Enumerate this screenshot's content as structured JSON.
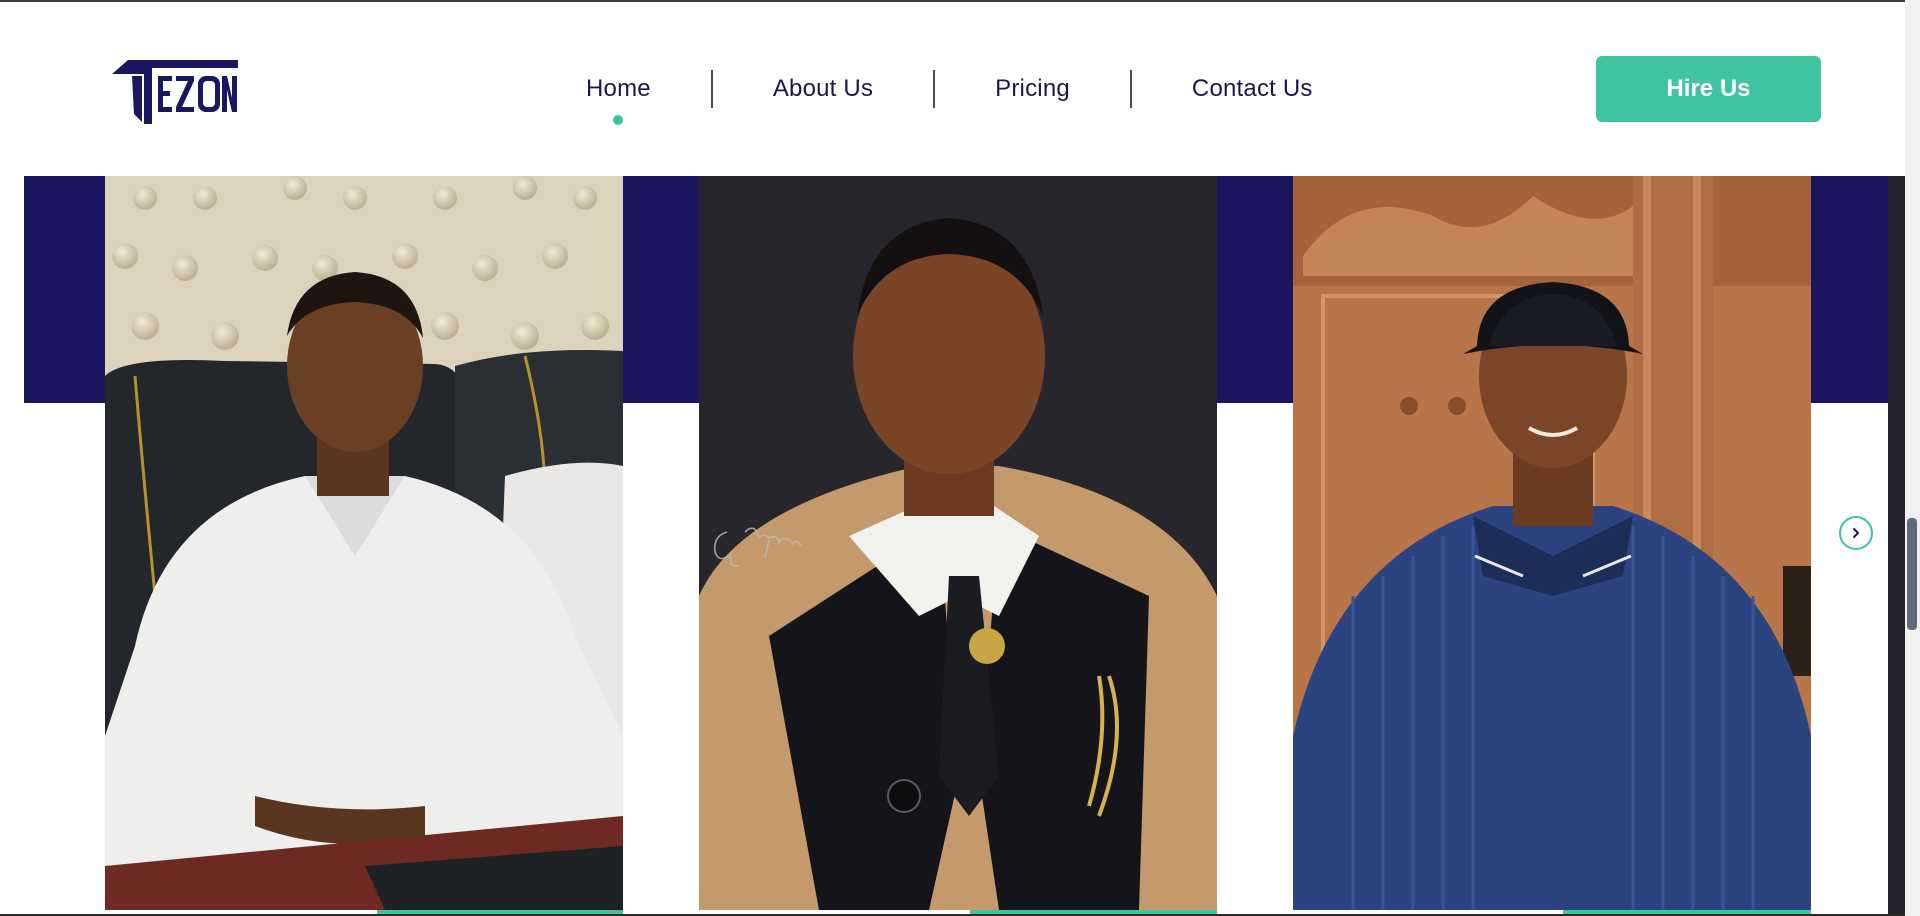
{
  "brand": {
    "name": "TEZON",
    "logo_icon": "tezon-logo",
    "navy": "#1b1660",
    "accent": "#3fc3a2"
  },
  "nav": {
    "items": [
      {
        "label": "Home",
        "active": true
      },
      {
        "label": "About Us",
        "active": false
      },
      {
        "label": "Pricing",
        "active": false
      },
      {
        "label": "Contact Us",
        "active": false
      }
    ]
  },
  "header": {
    "cta_label": "Hire Us"
  },
  "carousel": {
    "cards": [
      {
        "photo": "young man in white shirt at conference table"
      },
      {
        "photo": "young man in tan suit with brooch, dark background",
        "watermark": "Gaviskard"
      },
      {
        "photo": "young man in navy cap and knit polo by wooden door"
      }
    ],
    "next_icon": "chevron-right-icon"
  }
}
